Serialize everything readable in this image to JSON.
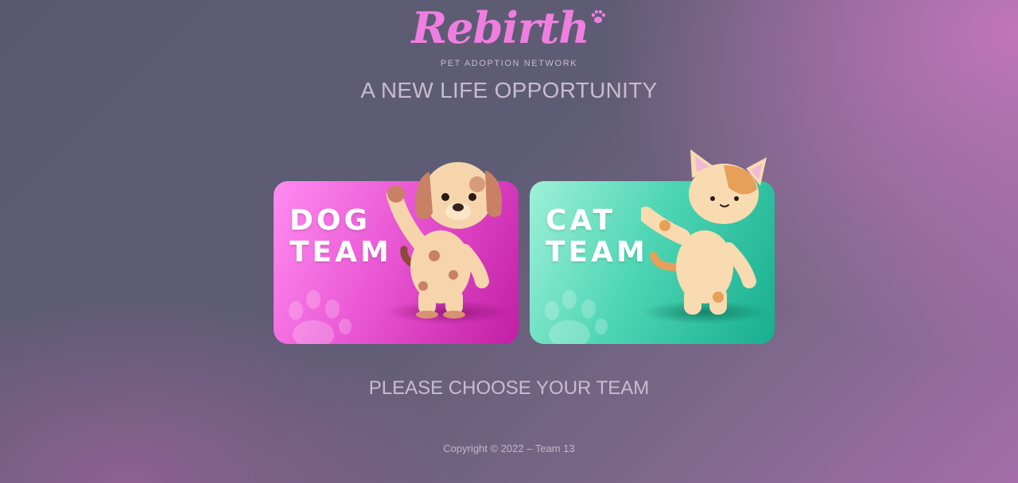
{
  "brand": {
    "name": "Rebirth",
    "subtitle": "PET ADOPTION NETWORK",
    "paw_icon": "paw-icon",
    "color": "#f07ee0"
  },
  "tagline": "A NEW LIFE OPPORTUNITY",
  "teams": [
    {
      "line1": "DOG",
      "line2": "TEAM",
      "pet_icon": "dog-figure",
      "colors": {
        "light": "#ff8cf0",
        "dark": "#c21ea5"
      }
    },
    {
      "line1": "CAT",
      "line2": "TEAM",
      "pet_icon": "cat-figure",
      "colors": {
        "light": "#9ff0d8",
        "dark": "#17ae8f"
      }
    }
  ],
  "prompt": "PLEASE CHOOSE YOUR TEAM",
  "footer": "Copyright © 2022 – Team 13"
}
